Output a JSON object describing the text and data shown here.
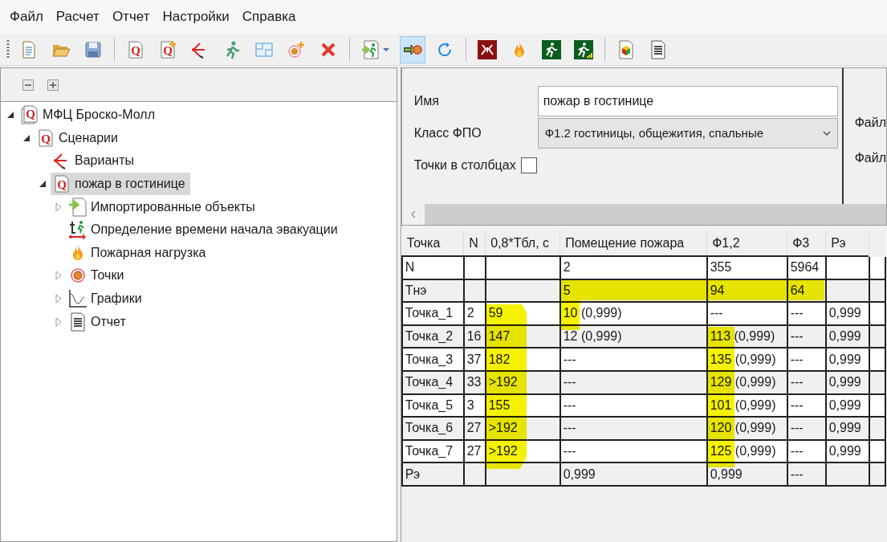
{
  "menu": [
    "Файл",
    "Расчет",
    "Отчет",
    "Настройки",
    "Справка"
  ],
  "toolbar": [
    [
      {
        "kind": "new-doc",
        "selected": false
      },
      {
        "kind": "open-folder",
        "selected": false
      },
      {
        "kind": "save",
        "selected": false
      }
    ],
    [
      {
        "kind": "q-doc",
        "icon_text": "Q",
        "selected": false
      },
      {
        "kind": "q-doc-plus",
        "icon_text": "Q",
        "selected": false
      },
      {
        "kind": "variants",
        "selected": false
      },
      {
        "kind": "runner",
        "selected": false
      },
      {
        "kind": "floorplan",
        "selected": false
      },
      {
        "kind": "target-plus",
        "selected": false
      },
      {
        "kind": "delete",
        "selected": false
      }
    ],
    [
      {
        "kind": "import-runner",
        "selected": false
      },
      {
        "kind": "import-target",
        "selected": true
      },
      {
        "kind": "refresh",
        "selected": false
      }
    ],
    [
      {
        "kind": "fire-box",
        "selected": false
      },
      {
        "kind": "flame",
        "selected": false
      },
      {
        "kind": "exit-box",
        "selected": false
      },
      {
        "kind": "exit-box-bars",
        "selected": false
      }
    ],
    [
      {
        "kind": "cube-doc",
        "selected": false
      },
      {
        "kind": "text-doc",
        "selected": false
      }
    ]
  ],
  "tree": [
    {
      "label": "МФЦ Броско-Молл",
      "kind": "project",
      "icon_text": "Q",
      "expanded": true,
      "selected": false,
      "children": [
        {
          "label": "Сценарии",
          "kind": "q-doc",
          "icon_text": "Q",
          "expanded": true,
          "selected": false,
          "children": [
            {
              "label": "Варианты",
              "kind": "variants",
              "selected": false
            },
            {
              "label": "пожар в гостинице",
              "kind": "q-doc",
              "icon_text": "Q",
              "expanded": true,
              "selected": true,
              "children": [
                {
                  "label": "Импортированные объекты",
                  "kind": "import",
                  "expanded": false,
                  "selected": false
                },
                {
                  "label": "Определение времени начала эвакуации",
                  "kind": "evac-time",
                  "selected": false
                },
                {
                  "label": "Пожарная нагрузка",
                  "kind": "flame",
                  "selected": false
                },
                {
                  "label": "Точки",
                  "kind": "target",
                  "expanded": false,
                  "selected": false
                },
                {
                  "label": "Графики",
                  "kind": "chart",
                  "expanded": false,
                  "selected": false
                },
                {
                  "label": "Отчет",
                  "kind": "text-doc",
                  "expanded": false,
                  "selected": false
                }
              ]
            }
          ]
        }
      ]
    }
  ],
  "form": {
    "name_label": "Имя",
    "name_value": "пожар в гостинице",
    "class_label": "Класс ФПО",
    "class_value": "Ф1.2 гостиницы, общежития, спальные",
    "columns_label": "Точки в столбцах",
    "columns_checked": false,
    "side_labels": [
      "Файл",
      "Файл"
    ]
  },
  "table": {
    "columns": [
      "Точка",
      "N",
      "0,8*Tбл, с",
      "Помещение пожара",
      "Ф1,2",
      "Ф3",
      "Рэ"
    ],
    "rows": [
      [
        "N",
        null,
        null,
        "2",
        "355",
        "5964",
        null
      ],
      [
        "Тнэ",
        null,
        null,
        "5",
        "94",
        "64",
        null
      ],
      [
        "Точка_1",
        "2",
        "59",
        "10 (0,999)",
        "---",
        "---",
        "0,999"
      ],
      [
        "Точка_2",
        "16",
        "147",
        "12 (0,999)",
        "113 (0,999)",
        "---",
        "0,999"
      ],
      [
        "Точка_3",
        "37",
        "182",
        "---",
        "135 (0,999)",
        "---",
        "0,999"
      ],
      [
        "Точка_4",
        "33",
        ">192",
        "---",
        "129 (0,999)",
        "---",
        "0,999"
      ],
      [
        "Точка_5",
        "3",
        "155",
        "---",
        "101 (0,999)",
        "---",
        "0,999"
      ],
      [
        "Точка_6",
        "27",
        ">192",
        "---",
        "120 (0,999)",
        "---",
        "0,999"
      ],
      [
        "Точка_7",
        "27",
        ">192",
        "---",
        "125 (0,999)",
        "---",
        "0,999"
      ],
      [
        "Рэ",
        null,
        null,
        "0,999",
        "0,999",
        "---",
        null
      ]
    ]
  }
}
